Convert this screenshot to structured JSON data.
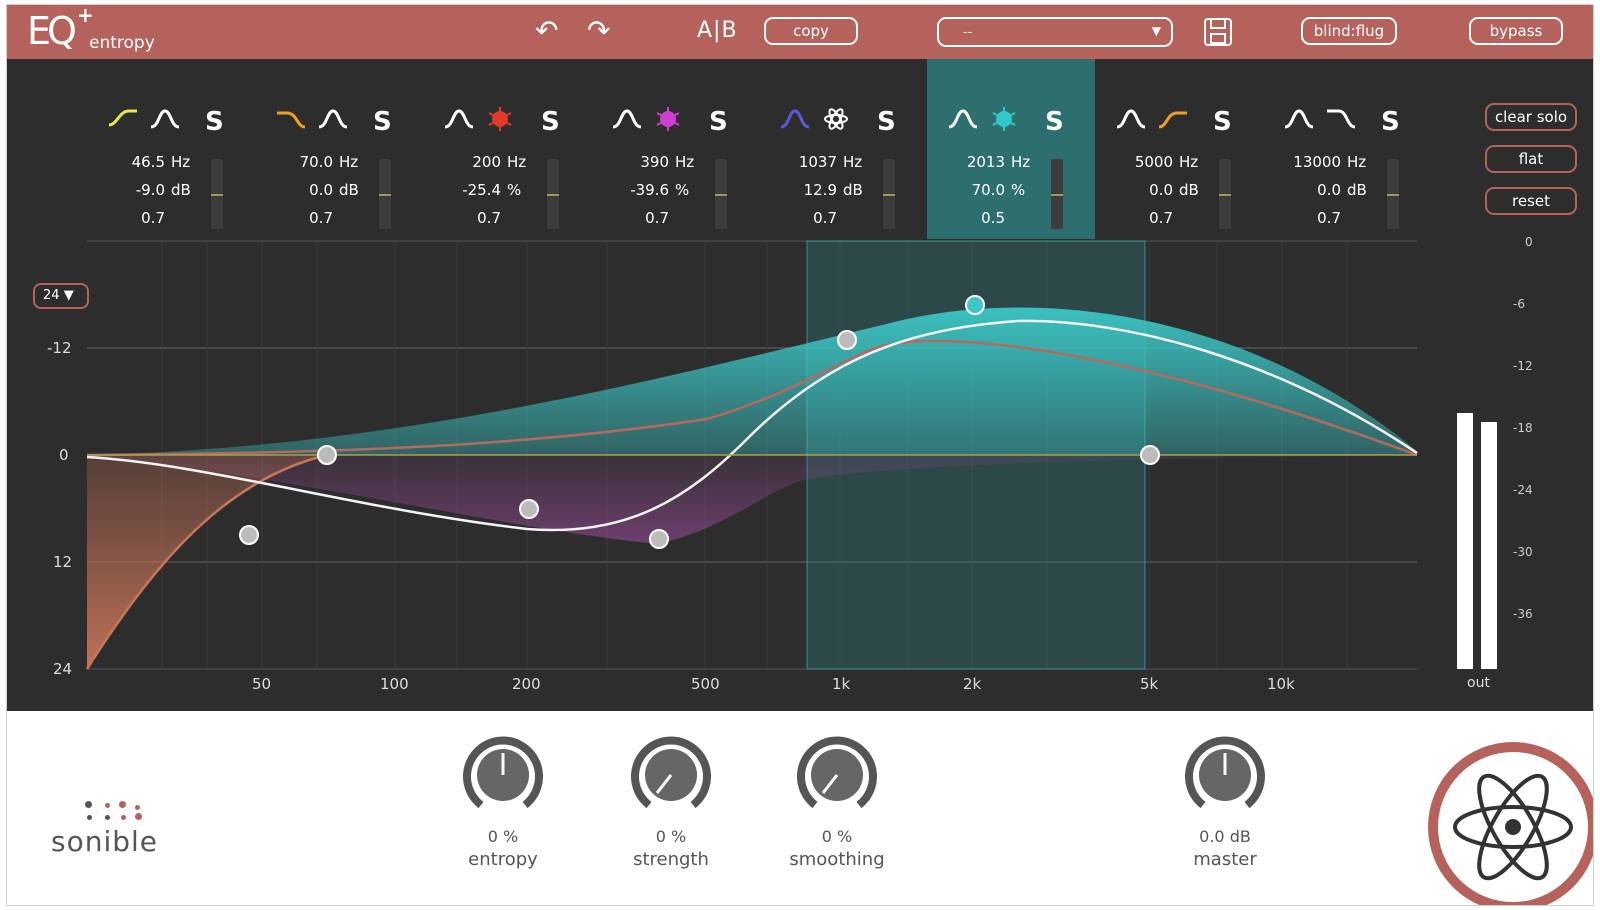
{
  "header": {
    "logo_text": "EQ",
    "logo_plus": "+",
    "product_name": "entropy",
    "ab_label": "A|B",
    "copy_label": "copy",
    "preset_value": "--",
    "blind_label": "blind:flug",
    "bypass_label": "bypass"
  },
  "bands": [
    {
      "freq": "46.5",
      "gain": "-9.0",
      "gain_unit": "dB",
      "q": "0.7",
      "icon_color": "#e8e84a",
      "shape": "highshelf",
      "shape2": "bell",
      "shape1_color": "#e8e84a",
      "shape2_color": "#ffffff",
      "fader": 0.5
    },
    {
      "freq": "70.0",
      "gain": "0.0",
      "gain_unit": "dB",
      "q": "0.7",
      "icon_color": "#f0a020",
      "shape": "lowcut",
      "shape2": "bell",
      "shape1_color": "#f0a020",
      "shape2_color": "#ffffff",
      "fader": 0.5
    },
    {
      "freq": "200",
      "gain": "-25.4",
      "gain_unit": "%",
      "q": "0.7",
      "icon_color": "#e03a2a",
      "shape": "bell",
      "shape2": "entropy",
      "shape1_color": "#ffffff",
      "shape2_color": "#e03a2a",
      "fader": 0.5
    },
    {
      "freq": "390",
      "gain": "-39.6",
      "gain_unit": "%",
      "q": "0.7",
      "icon_color": "#d040d0",
      "shape": "bell",
      "shape2": "entropy",
      "shape1_color": "#ffffff",
      "shape2_color": "#d040d0",
      "fader": 0.5
    },
    {
      "freq": "1037",
      "gain": "12.9",
      "gain_unit": "dB",
      "q": "0.7",
      "icon_color": "#5a5ad8",
      "shape": "bell",
      "shape2": "atom",
      "shape1_color": "#5a5ad8",
      "shape2_color": "#ffffff",
      "fader": 0.5
    },
    {
      "freq": "2013",
      "gain": "70.0",
      "gain_unit": "%",
      "q": "0.5",
      "icon_color": "#30c8c8",
      "shape": "bell",
      "shape2": "entropy",
      "shape1_color": "#ffffff",
      "shape2_color": "#30c8c8",
      "fader": 0.5,
      "active": true
    },
    {
      "freq": "5000",
      "gain": "0.0",
      "gain_unit": "dB",
      "q": "0.7",
      "icon_color": "#f0a020",
      "shape": "bell",
      "shape2": "highcut",
      "shape1_color": "#ffffff",
      "shape2_color": "#f0a020",
      "fader": 0.5
    },
    {
      "freq": "13000",
      "gain": "0.0",
      "gain_unit": "dB",
      "q": "0.7",
      "icon_color": "#ffffff",
      "shape": "bell",
      "shape2": "highshelf-down",
      "shape1_color": "#ffffff",
      "shape2_color": "#ffffff",
      "fader": 0.5
    }
  ],
  "units": {
    "hz": "Hz",
    "solo": "S"
  },
  "side_buttons": {
    "clear_solo": "clear solo",
    "flat": "flat",
    "reset": "reset"
  },
  "range_value": "24",
  "graph": {
    "y_labels": [
      "-12",
      "0",
      "12",
      "24"
    ],
    "x_labels": [
      "50",
      "100",
      "200",
      "500",
      "1k",
      "2k",
      "5k",
      "10k"
    ],
    "meter_scale": [
      "0",
      "-6",
      "-12",
      "-18",
      "-24",
      "-30",
      "-36"
    ],
    "meter_label": "out",
    "meter_levels": [
      0.6,
      0.58
    ]
  },
  "brand": "sonible",
  "knobs": [
    {
      "value": "0 %",
      "label": "entropy"
    },
    {
      "value": "0 %",
      "label": "strength"
    },
    {
      "value": "0 %",
      "label": "smoothing"
    },
    {
      "value": "0.0 dB",
      "label": "master"
    }
  ],
  "colors": {
    "accent": "#b5625c",
    "teal": "#30c8c8",
    "dark_bg": "#2d2d2d"
  }
}
